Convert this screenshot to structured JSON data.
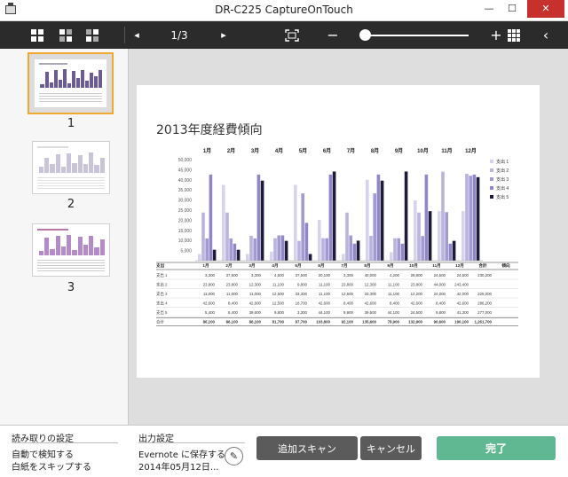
{
  "window": {
    "title": "DR-C225 CaptureOnTouch",
    "min_glyph": "—",
    "max_glyph": "☐",
    "close_glyph": "✕"
  },
  "toolbar": {
    "page_indicator": "1/3",
    "prev_glyph": "◂",
    "next_glyph": "▸",
    "zoom_out_glyph": "−",
    "zoom_in_glyph": "+",
    "collapse_glyph": "‹",
    "zoom_level": 0.03
  },
  "thumbnails": [
    {
      "number": "1",
      "selected": true
    },
    {
      "number": "2",
      "selected": false
    },
    {
      "number": "3",
      "selected": false
    }
  ],
  "document": {
    "title": "2013年度経費傾向",
    "table_headers": [
      "支出",
      "1月",
      "2月",
      "3月",
      "4月",
      "5月",
      "6月",
      "7月",
      "8月",
      "9月",
      "10月",
      "11月",
      "12月",
      "合計",
      "傾向"
    ],
    "table_rows": [
      {
        "label": "支出 1",
        "values": [
          "3,300",
          "37,500",
          "3,300",
          "4,500",
          "37,500",
          "20,100",
          "3,300",
          "40,000",
          "4,200",
          "29,800",
          "24,500",
          "24,500",
          "230,200"
        ]
      },
      {
        "label": "支出 2",
        "values": [
          "23,800",
          "23,800",
          "12,300",
          "11,100",
          "9,800",
          "11,100",
          "23,800",
          "12,300",
          "11,100",
          "23,800",
          "44,000",
          "243,400",
          ""
        ]
      },
      {
        "label": "支出 3",
        "values": [
          "11,000",
          "11,000",
          "11,000",
          "12,500",
          "33,300",
          "11,100",
          "12,500",
          "33,300",
          "11,100",
          "12,200",
          "24,000",
          "42,000",
          "225,000"
        ]
      },
      {
        "label": "支出 4",
        "values": [
          "42,600",
          "8,400",
          "42,600",
          "12,500",
          "18,700",
          "42,600",
          "8,400",
          "42,600",
          "8,400",
          "42,600",
          "8,400",
          "42,600",
          "286,200"
        ]
      },
      {
        "label": "支出 5",
        "values": [
          "5,400",
          "5,400",
          "39,600",
          "9,800",
          "3,300",
          "44,100",
          "9,900",
          "39,600",
          "44,100",
          "24,500",
          "9,800",
          "41,300",
          "277,000"
        ]
      },
      {
        "label": "合計",
        "values": [
          "86,100",
          "86,100",
          "86,100",
          "81,700",
          "97,700",
          "103,800",
          "92,100",
          "135,600",
          "78,900",
          "132,900",
          "90,600",
          "190,100",
          "1,261,700"
        ]
      }
    ]
  },
  "chart_data": {
    "type": "bar",
    "title": "2013年度経費傾向",
    "categories": [
      "1月",
      "2月",
      "3月",
      "4月",
      "5月",
      "6月",
      "7月",
      "8月",
      "9月",
      "10月",
      "11月",
      "12月"
    ],
    "ylim": [
      0,
      50000
    ],
    "yticks": [
      "5,000",
      "10,000",
      "15,000",
      "20,000",
      "25,000",
      "30,000",
      "35,000",
      "40,000",
      "45,000",
      "50,000"
    ],
    "legend_position": "right",
    "series": [
      {
        "name": "支出 1",
        "color": "#d6d3ec",
        "values": [
          3300,
          37500,
          3300,
          4500,
          37500,
          20100,
          3300,
          40000,
          4200,
          29800,
          24500,
          24500
        ]
      },
      {
        "name": "支出 2",
        "color": "#b9b3dd",
        "values": [
          23800,
          23800,
          12300,
          11100,
          9800,
          11100,
          23800,
          12300,
          11100,
          23800,
          44000,
          43000
        ]
      },
      {
        "name": "支出 3",
        "color": "#a29bd2",
        "values": [
          11000,
          11000,
          11000,
          12500,
          33300,
          11100,
          12500,
          33300,
          11100,
          12200,
          24000,
          42000
        ]
      },
      {
        "name": "支出 4",
        "color": "#8f87c8",
        "values": [
          42600,
          8400,
          42600,
          12500,
          18700,
          42600,
          8400,
          42600,
          8400,
          42600,
          8400,
          42600
        ]
      },
      {
        "name": "支出 5",
        "color": "#1e1a3a",
        "values": [
          5400,
          5400,
          39600,
          9800,
          3300,
          44100,
          9900,
          39600,
          44100,
          24500,
          9800,
          41300
        ]
      }
    ]
  },
  "bottom": {
    "read_settings_title": "読み取りの設定",
    "read_setting_1": "自動で検知する",
    "read_setting_2": "白紙をスキップする",
    "output_title": "出力設定",
    "output_line_1": "Evernote に保存する",
    "output_line_2": "2014年05月12日...",
    "edit_glyph": "✎",
    "add_scan_label": "追加スキャン",
    "cancel_label": "キャンセル",
    "done_label": "完了"
  }
}
